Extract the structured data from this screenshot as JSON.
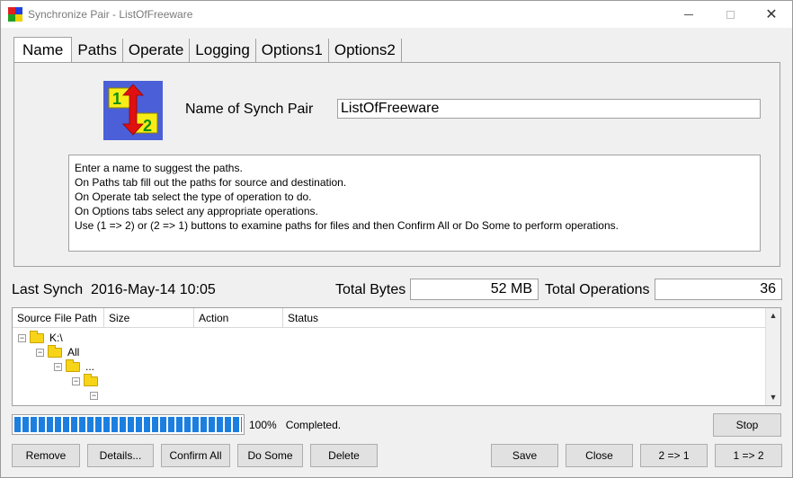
{
  "window": {
    "title": "Synchronize Pair - ListOfFreeware"
  },
  "tabs": [
    {
      "label": "Name"
    },
    {
      "label": "Paths"
    },
    {
      "label": "Operate"
    },
    {
      "label": "Logging"
    },
    {
      "label": "Options1"
    },
    {
      "label": "Options2"
    }
  ],
  "name_tab": {
    "name_label": "Name of Synch Pair",
    "name_value": "ListOfFreeware",
    "help_lines": [
      "Enter a name to suggest the paths.",
      "On Paths tab fill out the paths for source and destination.",
      "On Operate tab select the type of operation to do.",
      "On Options tabs select any appropriate operations.",
      "Use (1 => 2) or (2 => 1) buttons to examine paths for files and then Confirm All or Do Some to perform operations."
    ],
    "logo_digits": [
      "1",
      "2"
    ]
  },
  "stats": {
    "last_synch_label": "Last Synch",
    "last_synch_value": "2016-May-14 10:05",
    "total_bytes_label": "Total Bytes",
    "total_bytes_value": "52 MB",
    "total_ops_label": "Total Operations",
    "total_ops_value": "36"
  },
  "list": {
    "columns": [
      "Source File Path",
      "Size",
      "Action",
      "Status"
    ],
    "tree": [
      {
        "label": "K:\\"
      },
      {
        "label": "All"
      },
      {
        "label": "..."
      },
      {
        "label": ""
      },
      {
        "label": ""
      }
    ]
  },
  "progress": {
    "percent": 100,
    "percent_label": "100%",
    "status": "Completed."
  },
  "buttons": {
    "stop": "Stop",
    "remove": "Remove",
    "details": "Details...",
    "confirm_all": "Confirm All",
    "do_some": "Do Some",
    "delete": "Delete",
    "save": "Save",
    "close": "Close",
    "two_to_one": "2 => 1",
    "one_to_two": "1 => 2"
  },
  "colors": {
    "progress": "#1c7fe0",
    "logo_background": "#4a5fd8",
    "logo_arrow": "#e01010",
    "folder": "#f7d417"
  }
}
